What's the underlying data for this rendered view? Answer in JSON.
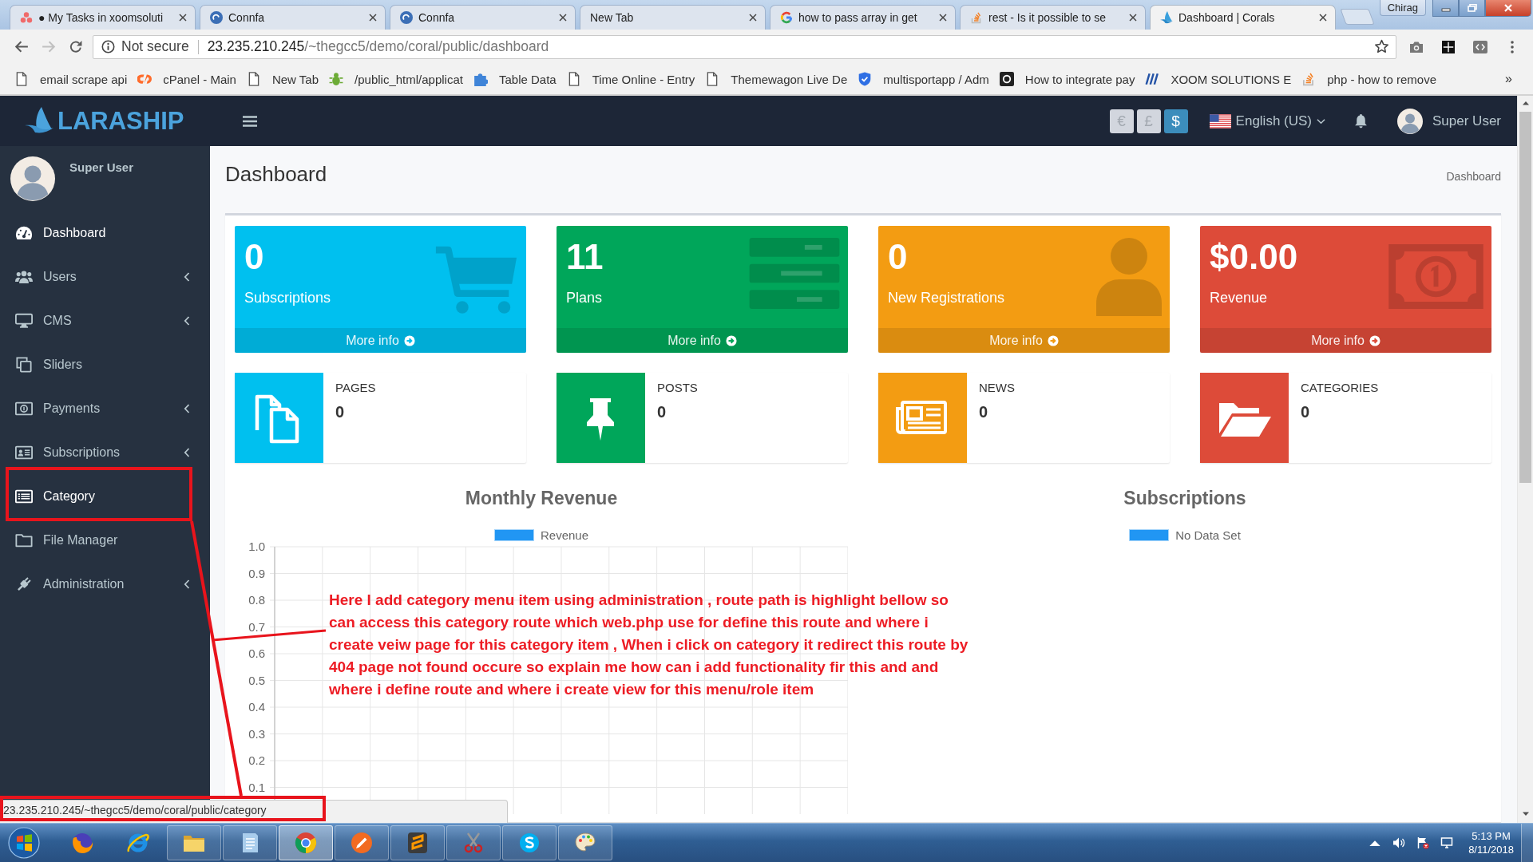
{
  "browser": {
    "tabs": [
      {
        "title": "● My Tasks in xoomsoluti",
        "kind": "dots",
        "selected": false
      },
      {
        "title": "Connfa",
        "kind": "globe",
        "selected": false
      },
      {
        "title": "Connfa",
        "kind": "globe",
        "selected": false
      },
      {
        "title": "New Tab",
        "kind": "none",
        "selected": false
      },
      {
        "title": "how to pass array in get",
        "kind": "letter-g",
        "selected": false
      },
      {
        "title": "rest - Is it possible to se",
        "kind": "stack",
        "selected": false
      },
      {
        "title": "Dashboard | Corals",
        "kind": "sail",
        "selected": true
      }
    ],
    "profile": "Chirag",
    "can_go_forward": false,
    "address": {
      "security": "Not secure",
      "host": "23.235.210.245",
      "path": "/~thegcc5/demo/coral/public/dashboard"
    },
    "bookmarks": [
      {
        "label": "email scrape api",
        "kind": "page"
      },
      {
        "label": "cPanel - Main",
        "kind": "swirl"
      },
      {
        "label": "New Tab",
        "kind": "page"
      },
      {
        "label": "/public_html/applicat",
        "kind": "bug"
      },
      {
        "label": "Table Data",
        "kind": "puzzle"
      },
      {
        "label": "Time Online - Entry",
        "kind": "page"
      },
      {
        "label": "Themewagon Live De",
        "kind": "page"
      },
      {
        "label": "multisportapp / Adm",
        "kind": "shield"
      },
      {
        "label": "How to integrate pay",
        "kind": "square"
      },
      {
        "label": "XOOM SOLUTIONS E",
        "kind": "bars"
      },
      {
        "label": "php - how to remove",
        "kind": "stack"
      }
    ],
    "bookmarks_overflow": "»",
    "status_url": "23.235.210.245/~thegcc5/demo/coral/public/category"
  },
  "app": {
    "logo": "LARASHIP",
    "currencies": [
      {
        "symbol": "€",
        "selected": false
      },
      {
        "symbol": "£",
        "selected": false
      },
      {
        "symbol": "$",
        "selected": true
      }
    ],
    "language": "English (US)",
    "user_name": "Super User",
    "sidebar": {
      "user_name": "Super User",
      "items": [
        {
          "label": "Dashboard",
          "kind": "gauge",
          "selected": true,
          "has_submenu": false
        },
        {
          "label": "Users",
          "kind": "users",
          "selected": false,
          "has_submenu": true
        },
        {
          "label": "CMS",
          "kind": "desktop",
          "selected": false,
          "has_submenu": true
        },
        {
          "label": "Sliders",
          "kind": "clone",
          "selected": false,
          "has_submenu": false
        },
        {
          "label": "Payments",
          "kind": "money",
          "selected": false,
          "has_submenu": true
        },
        {
          "label": "Subscriptions",
          "kind": "card",
          "selected": false,
          "has_submenu": true
        },
        {
          "label": "Category",
          "kind": "list",
          "selected": true,
          "has_submenu": false
        },
        {
          "label": "File Manager",
          "kind": "folder",
          "selected": false,
          "has_submenu": false
        },
        {
          "label": "Administration",
          "kind": "plug",
          "selected": false,
          "has_submenu": true
        }
      ]
    },
    "page_title": "Dashboard",
    "breadcrumb": "Dashboard",
    "stat_cards": [
      {
        "value": "0",
        "label": "Subscriptions",
        "link": "More info",
        "color": "#00c0ef",
        "kind": "cart"
      },
      {
        "value": "11",
        "label": "Plans",
        "link": "More info",
        "color": "#00a65a",
        "kind": "list"
      },
      {
        "value": "0",
        "label": "New Registrations",
        "link": "More info",
        "color": "#f39c12",
        "kind": "user"
      },
      {
        "value": "$0.00",
        "label": "Revenue",
        "link": "More info",
        "color": "#dd4b39",
        "kind": "money"
      }
    ],
    "info_boxes": [
      {
        "label": "PAGES",
        "value": "0",
        "color": "#00c0ef",
        "kind": "copy"
      },
      {
        "label": "POSTS",
        "value": "0",
        "color": "#00a65a",
        "kind": "pin"
      },
      {
        "label": "NEWS",
        "value": "0",
        "color": "#f39c12",
        "kind": "news"
      },
      {
        "label": "CATEGORIES",
        "value": "0",
        "color": "#dd4b39",
        "kind": "folder"
      }
    ],
    "revenue_chart": {
      "chart_data": {
        "type": "line",
        "title": "Monthly Revenue",
        "series": [
          {
            "name": "Revenue",
            "color": "#2196f3"
          }
        ],
        "ylim": [
          0,
          1
        ],
        "yticks": [
          {
            "value": 1,
            "label": "1.0"
          },
          0.9,
          0.8,
          0.7,
          0.6,
          0.5,
          0.4,
          0.3,
          0.2,
          0.1
        ],
        "grid": true
      }
    },
    "subscriptions_chart": {
      "title": "Subscriptions",
      "legend": [
        {
          "name": "No Data Set",
          "color": "#2196f3"
        }
      ]
    }
  },
  "annotation": {
    "text": "Here I add category menu item using administration , route path is highlight bellow so can access this category route which web.php use for define this route and where i create veiw page for this category item , When i click on category it redirect this route by 404 page not found occure so explain me how can i add functionality fir this and and where i define route and where i create view for this menu/role item"
  },
  "taskbar": {
    "apps": [
      {
        "kind": "fox-globe",
        "running": false,
        "selected": false
      },
      {
        "kind": "e-globe",
        "running": false,
        "selected": false
      },
      {
        "kind": "folder",
        "running": true,
        "selected": false
      },
      {
        "kind": "notebook",
        "running": true,
        "selected": false
      },
      {
        "kind": "ring-globe",
        "running": true,
        "selected": true
      },
      {
        "kind": "pen",
        "running": true,
        "selected": false
      },
      {
        "kind": "s-tile",
        "running": true,
        "selected": false
      },
      {
        "kind": "scissors",
        "running": true,
        "selected": false
      },
      {
        "kind": "s-cloud",
        "running": true,
        "selected": false
      },
      {
        "kind": "palette",
        "running": true,
        "selected": false
      }
    ],
    "time": "5:13 PM",
    "date": "8/11/2018"
  }
}
